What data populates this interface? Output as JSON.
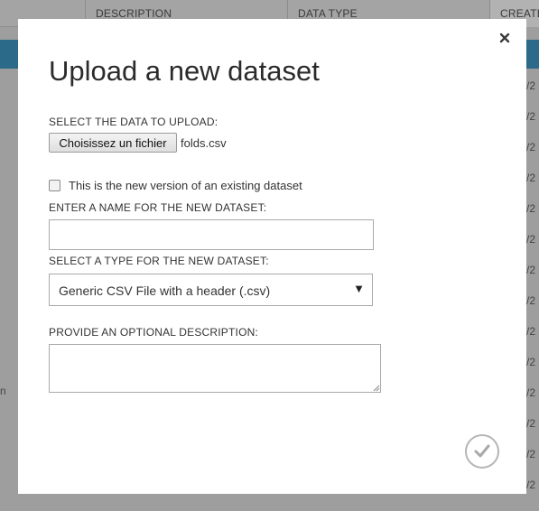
{
  "background": {
    "columns": {
      "description": "DESCRIPTION",
      "data_type": "DATA TYPE",
      "created": "CREATE"
    },
    "row_fragments": [
      "/2",
      "/2",
      "/2",
      "/2",
      "/2",
      "/2",
      "/2",
      "/2",
      "/2",
      "/2",
      "/2",
      "/2",
      "/2",
      "/2"
    ],
    "left_fragment": "n"
  },
  "dialog": {
    "title": "Upload a new dataset",
    "close_icon": "close-icon",
    "select_data_label": "SELECT THE DATA TO UPLOAD:",
    "file_button_label": "Choisissez un fichier",
    "file_name": "folds.csv",
    "new_version_checkbox": {
      "label": "This is the new version of an existing dataset",
      "checked": false
    },
    "name_label": "ENTER A NAME FOR THE NEW DATASET:",
    "name_value": "",
    "type_label": "SELECT A TYPE FOR THE NEW DATASET:",
    "type_value": "Generic CSV File with a header (.csv)",
    "description_label": "PROVIDE AN OPTIONAL DESCRIPTION:",
    "description_value": "",
    "ok_icon": "checkmark-icon"
  }
}
